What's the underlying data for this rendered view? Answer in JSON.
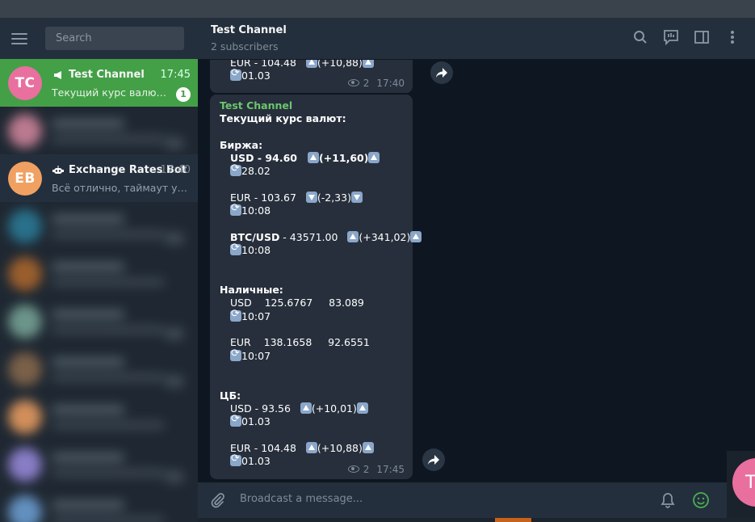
{
  "sidebar": {
    "search_placeholder": "Search",
    "chats": [
      {
        "initials": "TC",
        "title": "Test Channel",
        "time": "17:45",
        "preview": "Текущий курс валют:  Биржа:",
        "unread": "1",
        "avatar_color": "#e96f9e",
        "icon": "megaphone-icon"
      },
      {
        "initials": "EB",
        "title": "Exchange Rates Bot",
        "time": "17:40",
        "preview": "Всё отлично, таймаут установлен",
        "avatar_color": "#f0a162",
        "icon": "bot-icon"
      }
    ]
  },
  "header": {
    "title": "Test Channel",
    "subtitle": "2 subscribers"
  },
  "message1": {
    "eur_line": "EUR - 104.48",
    "eur_change": "(+10,88)",
    "date": "01.03",
    "views": "2",
    "time": "17:40"
  },
  "message2": {
    "sender": "Test Channel",
    "heading": "Текущий курс валют:",
    "exchange_title": "Биржа:",
    "usd_line": "USD - 94.60",
    "usd_change": "(+11,60)",
    "usd_date": "28.02",
    "eur_line": "EUR - 103.67",
    "eur_change": "(-2,33)",
    "eur_time": "10:08",
    "btc_label": "BTC/USD",
    "btc_value": " - 43571.00",
    "btc_change": "(+341,02)",
    "btc_time": "10:08",
    "cash_title": "Наличные:",
    "cash_usd": "USD    125.6767     83.089",
    "cash_usd_time": "10:07",
    "cash_eur": "EUR    138.1658     92.6551",
    "cash_eur_time": "10:07",
    "cb_title": "ЦБ:",
    "cb_usd_line": "USD - 93.56",
    "cb_usd_change": "(+10,01)",
    "cb_usd_date": "01.03",
    "cb_eur_line": "EUR - 104.48",
    "cb_eur_change": "(+10,88)",
    "cb_eur_date": "01.03",
    "views": "2",
    "time": "17:45"
  },
  "composer": {
    "placeholder": "Broadcast a message..."
  },
  "floating_avatar": {
    "letter": "T"
  },
  "colors": {
    "accent_green": "#43a047",
    "sender_green": "#6bc76c",
    "bubble": "#272f3c",
    "background": "#0e1621"
  }
}
